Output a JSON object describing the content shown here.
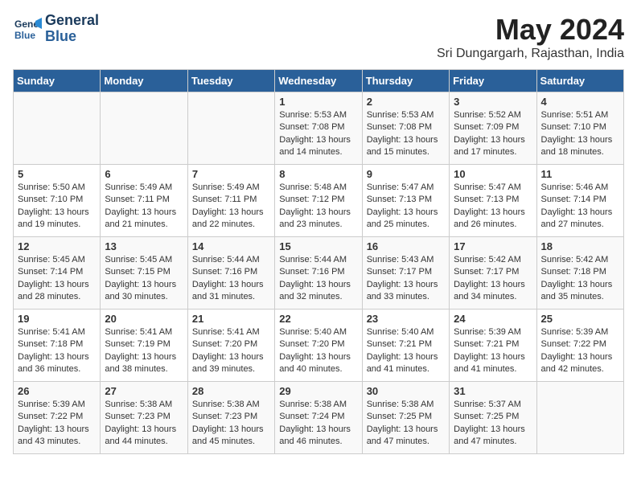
{
  "header": {
    "logo_line1": "General",
    "logo_line2": "Blue",
    "month": "May 2024",
    "location": "Sri Dungargarh, Rajasthan, India"
  },
  "weekdays": [
    "Sunday",
    "Monday",
    "Tuesday",
    "Wednesday",
    "Thursday",
    "Friday",
    "Saturday"
  ],
  "weeks": [
    [
      {
        "day": "",
        "info": ""
      },
      {
        "day": "",
        "info": ""
      },
      {
        "day": "",
        "info": ""
      },
      {
        "day": "1",
        "sunrise": "Sunrise: 5:53 AM",
        "sunset": "Sunset: 7:08 PM",
        "daylight": "Daylight: 13 hours and 14 minutes."
      },
      {
        "day": "2",
        "sunrise": "Sunrise: 5:53 AM",
        "sunset": "Sunset: 7:08 PM",
        "daylight": "Daylight: 13 hours and 15 minutes."
      },
      {
        "day": "3",
        "sunrise": "Sunrise: 5:52 AM",
        "sunset": "Sunset: 7:09 PM",
        "daylight": "Daylight: 13 hours and 17 minutes."
      },
      {
        "day": "4",
        "sunrise": "Sunrise: 5:51 AM",
        "sunset": "Sunset: 7:10 PM",
        "daylight": "Daylight: 13 hours and 18 minutes."
      }
    ],
    [
      {
        "day": "5",
        "sunrise": "Sunrise: 5:50 AM",
        "sunset": "Sunset: 7:10 PM",
        "daylight": "Daylight: 13 hours and 19 minutes."
      },
      {
        "day": "6",
        "sunrise": "Sunrise: 5:49 AM",
        "sunset": "Sunset: 7:11 PM",
        "daylight": "Daylight: 13 hours and 21 minutes."
      },
      {
        "day": "7",
        "sunrise": "Sunrise: 5:49 AM",
        "sunset": "Sunset: 7:11 PM",
        "daylight": "Daylight: 13 hours and 22 minutes."
      },
      {
        "day": "8",
        "sunrise": "Sunrise: 5:48 AM",
        "sunset": "Sunset: 7:12 PM",
        "daylight": "Daylight: 13 hours and 23 minutes."
      },
      {
        "day": "9",
        "sunrise": "Sunrise: 5:47 AM",
        "sunset": "Sunset: 7:13 PM",
        "daylight": "Daylight: 13 hours and 25 minutes."
      },
      {
        "day": "10",
        "sunrise": "Sunrise: 5:47 AM",
        "sunset": "Sunset: 7:13 PM",
        "daylight": "Daylight: 13 hours and 26 minutes."
      },
      {
        "day": "11",
        "sunrise": "Sunrise: 5:46 AM",
        "sunset": "Sunset: 7:14 PM",
        "daylight": "Daylight: 13 hours and 27 minutes."
      }
    ],
    [
      {
        "day": "12",
        "sunrise": "Sunrise: 5:45 AM",
        "sunset": "Sunset: 7:14 PM",
        "daylight": "Daylight: 13 hours and 28 minutes."
      },
      {
        "day": "13",
        "sunrise": "Sunrise: 5:45 AM",
        "sunset": "Sunset: 7:15 PM",
        "daylight": "Daylight: 13 hours and 30 minutes."
      },
      {
        "day": "14",
        "sunrise": "Sunrise: 5:44 AM",
        "sunset": "Sunset: 7:16 PM",
        "daylight": "Daylight: 13 hours and 31 minutes."
      },
      {
        "day": "15",
        "sunrise": "Sunrise: 5:44 AM",
        "sunset": "Sunset: 7:16 PM",
        "daylight": "Daylight: 13 hours and 32 minutes."
      },
      {
        "day": "16",
        "sunrise": "Sunrise: 5:43 AM",
        "sunset": "Sunset: 7:17 PM",
        "daylight": "Daylight: 13 hours and 33 minutes."
      },
      {
        "day": "17",
        "sunrise": "Sunrise: 5:42 AM",
        "sunset": "Sunset: 7:17 PM",
        "daylight": "Daylight: 13 hours and 34 minutes."
      },
      {
        "day": "18",
        "sunrise": "Sunrise: 5:42 AM",
        "sunset": "Sunset: 7:18 PM",
        "daylight": "Daylight: 13 hours and 35 minutes."
      }
    ],
    [
      {
        "day": "19",
        "sunrise": "Sunrise: 5:41 AM",
        "sunset": "Sunset: 7:18 PM",
        "daylight": "Daylight: 13 hours and 36 minutes."
      },
      {
        "day": "20",
        "sunrise": "Sunrise: 5:41 AM",
        "sunset": "Sunset: 7:19 PM",
        "daylight": "Daylight: 13 hours and 38 minutes."
      },
      {
        "day": "21",
        "sunrise": "Sunrise: 5:41 AM",
        "sunset": "Sunset: 7:20 PM",
        "daylight": "Daylight: 13 hours and 39 minutes."
      },
      {
        "day": "22",
        "sunrise": "Sunrise: 5:40 AM",
        "sunset": "Sunset: 7:20 PM",
        "daylight": "Daylight: 13 hours and 40 minutes."
      },
      {
        "day": "23",
        "sunrise": "Sunrise: 5:40 AM",
        "sunset": "Sunset: 7:21 PM",
        "daylight": "Daylight: 13 hours and 41 minutes."
      },
      {
        "day": "24",
        "sunrise": "Sunrise: 5:39 AM",
        "sunset": "Sunset: 7:21 PM",
        "daylight": "Daylight: 13 hours and 41 minutes."
      },
      {
        "day": "25",
        "sunrise": "Sunrise: 5:39 AM",
        "sunset": "Sunset: 7:22 PM",
        "daylight": "Daylight: 13 hours and 42 minutes."
      }
    ],
    [
      {
        "day": "26",
        "sunrise": "Sunrise: 5:39 AM",
        "sunset": "Sunset: 7:22 PM",
        "daylight": "Daylight: 13 hours and 43 minutes."
      },
      {
        "day": "27",
        "sunrise": "Sunrise: 5:38 AM",
        "sunset": "Sunset: 7:23 PM",
        "daylight": "Daylight: 13 hours and 44 minutes."
      },
      {
        "day": "28",
        "sunrise": "Sunrise: 5:38 AM",
        "sunset": "Sunset: 7:23 PM",
        "daylight": "Daylight: 13 hours and 45 minutes."
      },
      {
        "day": "29",
        "sunrise": "Sunrise: 5:38 AM",
        "sunset": "Sunset: 7:24 PM",
        "daylight": "Daylight: 13 hours and 46 minutes."
      },
      {
        "day": "30",
        "sunrise": "Sunrise: 5:38 AM",
        "sunset": "Sunset: 7:25 PM",
        "daylight": "Daylight: 13 hours and 47 minutes."
      },
      {
        "day": "31",
        "sunrise": "Sunrise: 5:37 AM",
        "sunset": "Sunset: 7:25 PM",
        "daylight": "Daylight: 13 hours and 47 minutes."
      },
      {
        "day": "",
        "info": ""
      }
    ]
  ]
}
